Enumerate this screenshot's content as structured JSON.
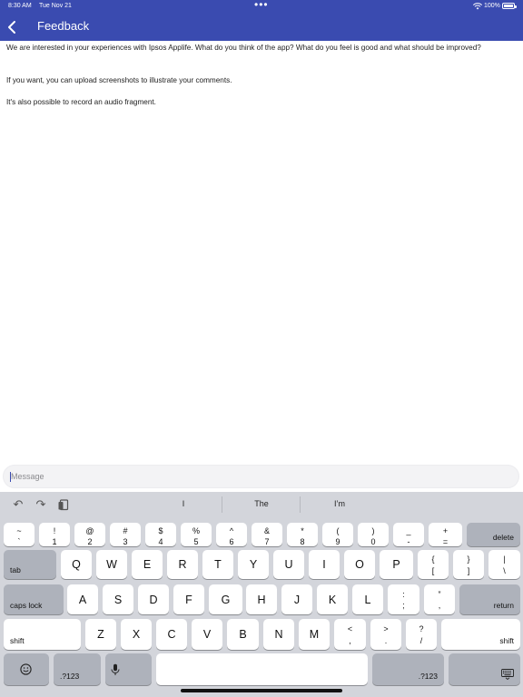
{
  "status_bar": {
    "time": "8:30 AM",
    "date": "Tue Nov 21",
    "dots": "•••",
    "battery": "100%"
  },
  "header": {
    "title": "Feedback"
  },
  "content": {
    "paragraphs": [
      "We are interested in your experiences with Ipsos Applife. What do you think of the app? What do you feel is good and what should be improved?",
      "If you want, you can upload screenshots to illustrate your comments.",
      "It's also possible to record an audio fragment."
    ]
  },
  "message": {
    "placeholder": "Message",
    "value": ""
  },
  "keyboard": {
    "suggestions": [
      "I",
      "The",
      "I’m"
    ],
    "row1": [
      {
        "top": "~",
        "bot": "`"
      },
      {
        "top": "!",
        "bot": "1"
      },
      {
        "top": "@",
        "bot": "2"
      },
      {
        "top": "#",
        "bot": "3"
      },
      {
        "top": "$",
        "bot": "4"
      },
      {
        "top": "%",
        "bot": "5"
      },
      {
        "top": "^",
        "bot": "6"
      },
      {
        "top": "&",
        "bot": "7"
      },
      {
        "top": "*",
        "bot": "8"
      },
      {
        "top": "(",
        "bot": "9"
      },
      {
        "top": ")",
        "bot": "0"
      },
      {
        "top": "_",
        "bot": "-"
      },
      {
        "top": "+",
        "bot": "="
      }
    ],
    "delete_label": "delete",
    "tab_label": "tab",
    "row2": [
      "Q",
      "W",
      "E",
      "R",
      "T",
      "Y",
      "U",
      "I",
      "O",
      "P"
    ],
    "row2_pairs": [
      {
        "top": "{",
        "bot": "["
      },
      {
        "top": "}",
        "bot": "]"
      },
      {
        "top": "|",
        "bot": "\\"
      }
    ],
    "caps_label": "caps lock",
    "row3": [
      "A",
      "S",
      "D",
      "F",
      "G",
      "H",
      "J",
      "K",
      "L"
    ],
    "row3_pairs": [
      {
        "top": ":",
        "bot": ";"
      },
      {
        "top": "”",
        "bot": ","
      }
    ],
    "return_label": "return",
    "shift_label": "shift",
    "row4": [
      "Z",
      "X",
      "C",
      "V",
      "B",
      "N",
      "M"
    ],
    "row4_pairs": [
      {
        "top": "<",
        "bot": ","
      },
      {
        "top": ">",
        "bot": "."
      },
      {
        "top": "?",
        "bot": "/"
      }
    ],
    "numbers_label": ".?123",
    "icons": {
      "undo": "undo-icon",
      "redo": "redo-icon",
      "paste": "clipboard-icon",
      "emoji": "emoji-icon",
      "mic": "microphone-icon",
      "dismiss": "keyboard-dismiss-icon"
    }
  }
}
